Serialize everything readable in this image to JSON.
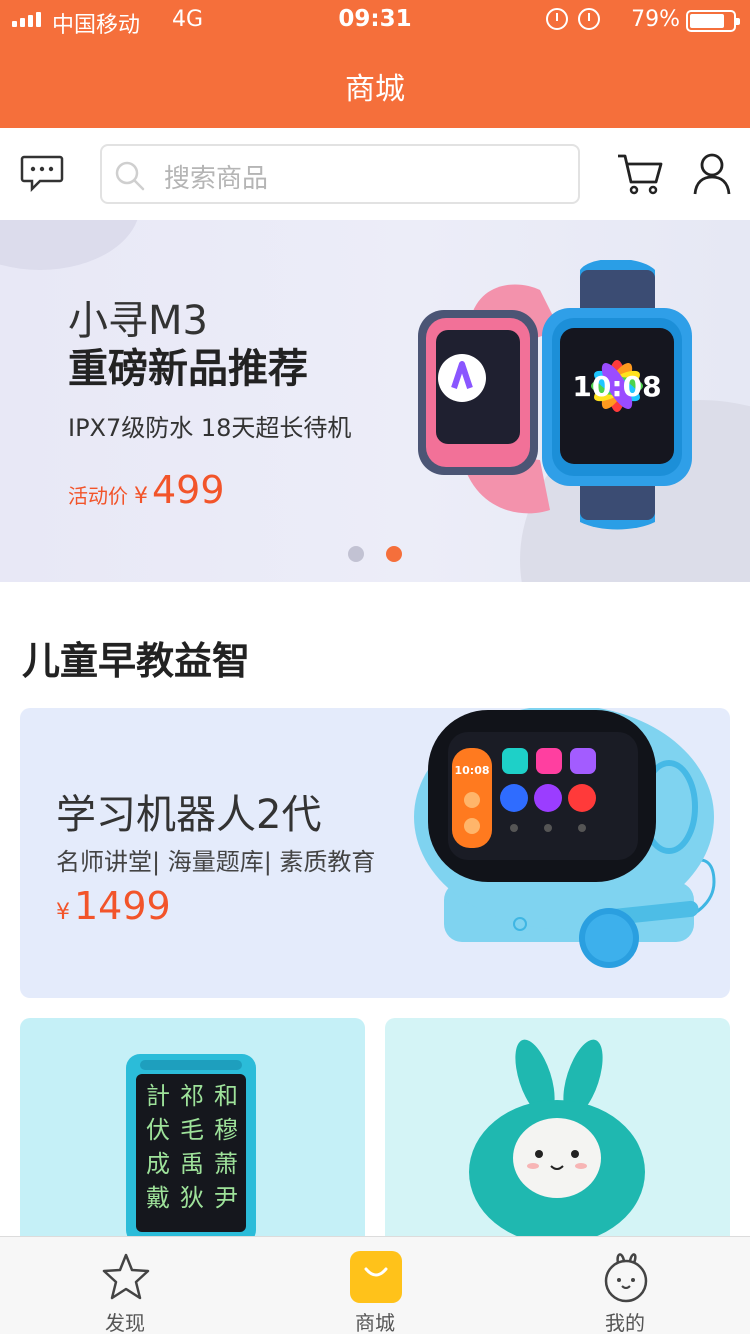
{
  "status_bar": {
    "carrier": "中国移动",
    "network": "4G",
    "time": "09:31",
    "battery": "79%",
    "battery_level": 0.79
  },
  "nav": {
    "title": "商城"
  },
  "search": {
    "placeholder": "搜索商品"
  },
  "banner": {
    "title_line1": "小寻M3",
    "title_line2": "重磅新品推荐",
    "subtitle": "IPX7级防水 18天超长待机",
    "price_label": "活动价",
    "currency": "¥",
    "price": "499",
    "watch_screen_time": "10:08",
    "slide_count": 2,
    "active_slide": 2
  },
  "section": {
    "title": "儿童早教益智"
  },
  "product_featured": {
    "name": "学习机器人2代",
    "features": "名师讲堂| 海量题库| 素质教育",
    "currency": "¥",
    "price": "1499",
    "screen_time": "10:08"
  },
  "product_tablet": {
    "screen_chars": [
      "計",
      "祁",
      "和",
      "伏",
      "毛",
      "穆",
      "成",
      "禹",
      "萧",
      "戴",
      "狄",
      "尹"
    ]
  },
  "tabs": [
    {
      "label": "发现",
      "icon": "star-icon",
      "active": false
    },
    {
      "label": "商城",
      "icon": "shopping-bag-icon",
      "active": true
    },
    {
      "label": "我的",
      "icon": "bunny-face-icon",
      "active": false
    }
  ],
  "colors": {
    "brand": "#f56f3b",
    "price": "#f2542a",
    "tab_active": "#ffc21a"
  }
}
